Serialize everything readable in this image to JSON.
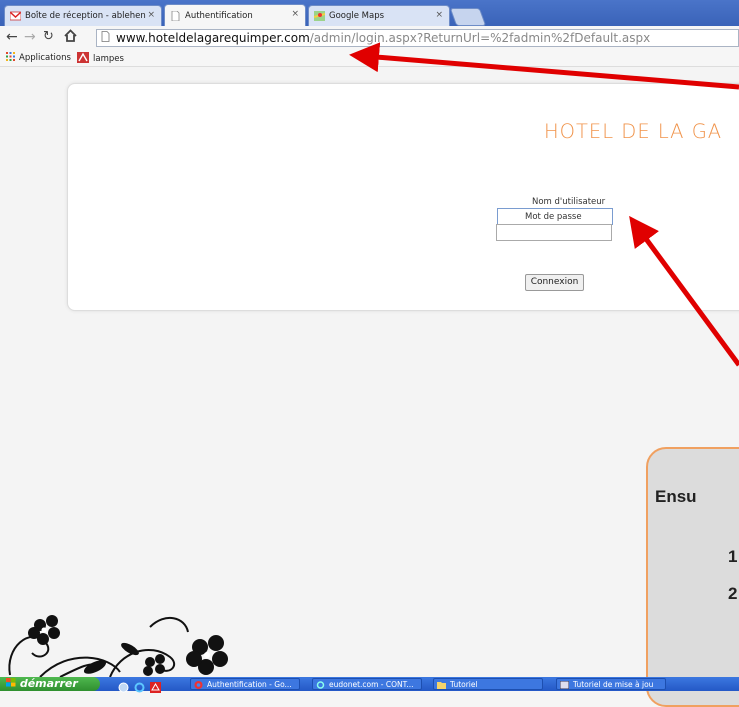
{
  "browser": {
    "tabs": [
      {
        "label": "Boîte de réception - ablehen",
        "close": "×"
      },
      {
        "label": "Authentification",
        "close": "×"
      },
      {
        "label": "Google Maps",
        "close": "×"
      }
    ],
    "url_host": "www.hoteldelagarequimper.com",
    "url_path": "/admin/login.aspx?ReturnUrl=%2fadmin%2fDefault.aspx",
    "bookmarks": [
      {
        "label": "Applications"
      },
      {
        "label": "lampes"
      }
    ]
  },
  "login": {
    "hotel_title": "HOTEL DE LA GA",
    "username_label": "Nom d'utilisateur",
    "password_label": "Mot de passe",
    "connect_button": "Connexion"
  },
  "callout": {
    "line1": "Ensu",
    "line2": "1",
    "line3": "2"
  },
  "taskbar": {
    "start_label": "démarrer",
    "tasks": [
      {
        "label": "Authentification - Go..."
      },
      {
        "label": "eudonet.com - CONT..."
      },
      {
        "label": "Tutoriel"
      },
      {
        "label": "Tutoriel de mise à jou"
      }
    ]
  },
  "colors": {
    "hotel_orange": "#f0934a",
    "arrow_red": "#e00000",
    "callout_border": "#f0a060"
  }
}
